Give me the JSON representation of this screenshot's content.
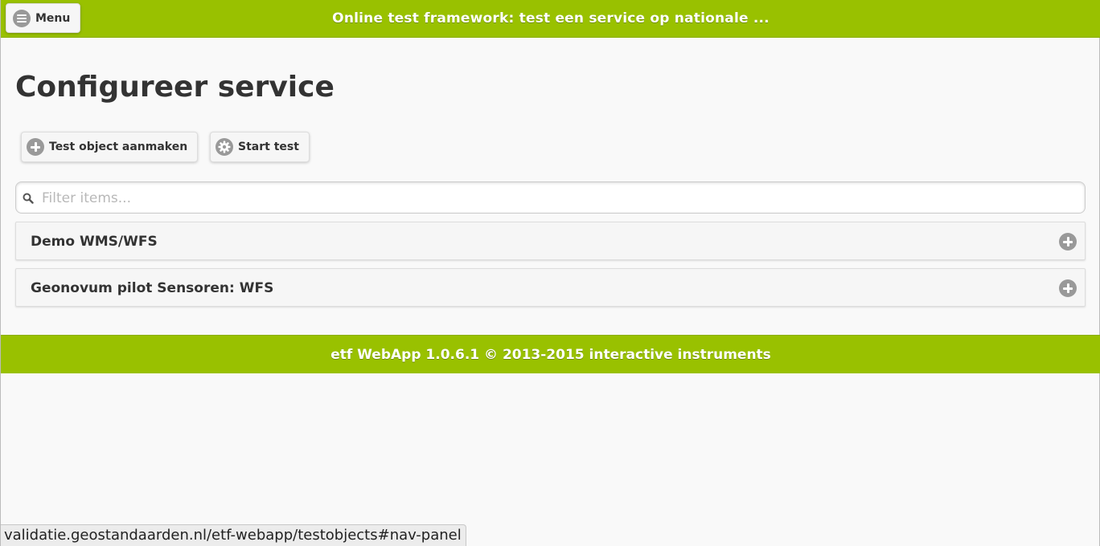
{
  "header": {
    "menu_label": "Menu",
    "title": "Online test framework: test een service op nationale ..."
  },
  "page": {
    "title": "Configureer service"
  },
  "toolbar": {
    "create_label": "Test object aanmaken",
    "start_label": "Start test"
  },
  "search": {
    "placeholder": "Filter items..."
  },
  "items": [
    {
      "label": "Demo WMS/WFS"
    },
    {
      "label": "Geonovum pilot Sensoren: WFS"
    }
  ],
  "footer": {
    "text": "etf WebApp 1.0.6.1 © 2013-2015 interactive instruments"
  },
  "status_bar": {
    "url": "validatie.geostandaarden.nl/etf-webapp/testobjects#nav-panel"
  },
  "colors": {
    "accent": "#99c100",
    "icon_gray": "#999999"
  }
}
